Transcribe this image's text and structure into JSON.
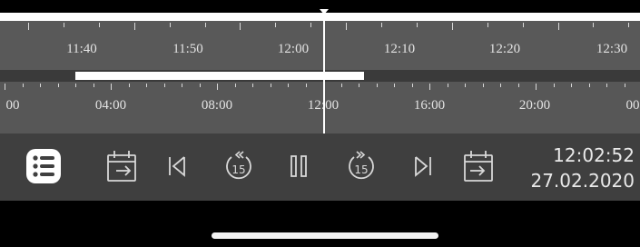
{
  "timeline_top": {
    "labels": [
      "11:40",
      "11:50",
      "12:00",
      "12:10",
      "12:20",
      "12:30"
    ]
  },
  "timeline_bottom": {
    "labels": [
      "00",
      "04:00",
      "08:00",
      "12:00",
      "16:00",
      "20:00",
      "00"
    ]
  },
  "controls": {
    "list": {
      "icon": "list-icon"
    },
    "select_start_date": {
      "icon": "calendar-arrow-in-icon"
    },
    "skip_previous": {
      "icon": "skip-previous-icon"
    },
    "rewind_15": {
      "icon": "rewind-15-icon",
      "label": "15"
    },
    "pause": {
      "icon": "pause-icon"
    },
    "forward_15": {
      "icon": "forward-15-icon",
      "label": "15"
    },
    "skip_next": {
      "icon": "skip-next-icon"
    },
    "select_end_date": {
      "icon": "calendar-arrow-out-icon"
    }
  },
  "datetime": {
    "time": "12:02:52",
    "date": "27.02.2020"
  },
  "colors": {
    "track": "#595959",
    "controls_bar": "#3f3f3f",
    "playhead": "#ffffff",
    "text": "#e9e9e9"
  }
}
